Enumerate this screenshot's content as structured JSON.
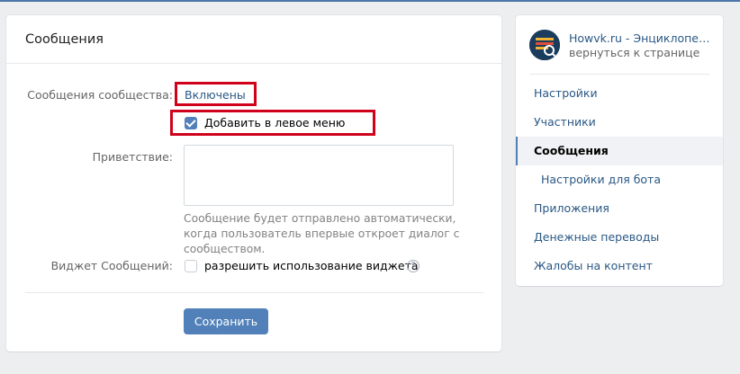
{
  "main": {
    "title": "Сообщения",
    "messages_label": "Сообщения сообщества:",
    "messages_value": "Включены",
    "left_menu_checkbox": {
      "label": "Добавить в левое меню",
      "checked": true
    },
    "greeting_label": "Приветствие:",
    "greeting_value": "",
    "greeting_hint": "Сообщение будет отправлено автоматически, когда пользователь впервые откроет диалог с сообществом.",
    "widget_label": "Виджет Сообщений:",
    "widget_checkbox": {
      "label": "разрешить использование виджета",
      "checked": false
    },
    "help_glyph": "?",
    "save_label": "Сохранить"
  },
  "sidebar": {
    "community_name": "Howvk.ru - Энциклопедия ВКонтакте",
    "back_link": "вернуться к странице",
    "items": [
      {
        "label": "Настройки"
      },
      {
        "label": "Участники"
      },
      {
        "label": "Сообщения",
        "active": true
      },
      {
        "label": "Настройки для бота",
        "sub": true
      },
      {
        "label": "Приложения"
      },
      {
        "label": "Денежные переводы"
      },
      {
        "label": "Жалобы на контент"
      }
    ]
  },
  "colors": {
    "accent": "#5181b8",
    "link": "#2a5885",
    "highlight": "#d0021b",
    "background": "#edeef0"
  },
  "icons": {
    "checkbox_checked": "checkmark-icon",
    "help": "question-circle-icon",
    "avatar": "community-avatar"
  }
}
